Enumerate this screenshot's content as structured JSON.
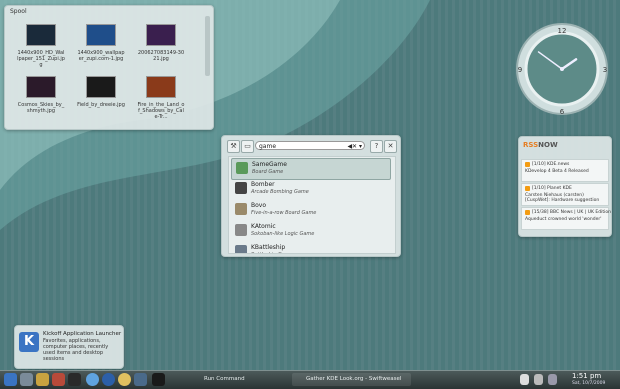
{
  "folderview": {
    "title": "Spool",
    "files": [
      {
        "name": "1440x900_HD_Wallpaper_151_Zupi.jpg",
        "color": "#1a2a3a"
      },
      {
        "name": "1440x900_wallpaper_zupi.com-1.jpg",
        "color": "#1f4e8a"
      },
      {
        "name": "200627083149-3021.jpg",
        "color": "#3a1f4e"
      },
      {
        "name": "Cosmos_Skies_by_shmyth.jpg",
        "color": "#2b1a2a"
      },
      {
        "name": "Field_by_dreeie.jpg",
        "color": "#1a1a1a"
      },
      {
        "name": "Fire_in_the_Land_of_Shadows_by_Cale-Tr...",
        "color": "#8a3a1a"
      }
    ]
  },
  "runner": {
    "query": "game",
    "results": [
      {
        "name": "SameGame",
        "desc": "Board Game",
        "selected": true,
        "color": "#5a9a5a"
      },
      {
        "name": "Bomber",
        "desc": "Arcade Bombing Game",
        "selected": false,
        "color": "#444"
      },
      {
        "name": "Bovo",
        "desc": "Five-in-a-row Board Game",
        "selected": false,
        "color": "#9a8a6a"
      },
      {
        "name": "KAtomic",
        "desc": "Sokoban-like Logic Game",
        "selected": false,
        "color": "#888"
      },
      {
        "name": "KBattleship",
        "desc": "Battleship Game",
        "selected": false,
        "color": "#6a7a8a"
      }
    ]
  },
  "clock": {
    "numerals": [
      "12",
      "3",
      "6",
      "9"
    ],
    "hour": 1,
    "minute": 51
  },
  "rss": {
    "brand_a": "RSS",
    "brand_b": "NOW",
    "items": [
      {
        "source": "[1/10] KDE.news",
        "text": "KDevelop 4 Beta 4 Released"
      },
      {
        "source": "[1/10] Planet KDE",
        "text": "Carsten Niehaus (carsten) [CuspWet]: Hardware suggestion"
      },
      {
        "source": "[15/38] BBC News | UK | UK Edition",
        "text": "Aqueduct crowned world 'wonder'"
      }
    ]
  },
  "tooltip": {
    "title": "Kickoff Application Launcher",
    "desc": "Favorites, applications, computer places, recently used items and desktop sessions"
  },
  "taskbar": {
    "run_command": "Run Command",
    "task2": "Gather KDE Look.org - Swiftweasel",
    "time": "1:51 pm",
    "date": "Sat, 10/7/2009"
  },
  "colors": {
    "accent": "#4d7a7c",
    "rss_orange": "#f39c12",
    "kde_blue": "#3a74c3"
  }
}
